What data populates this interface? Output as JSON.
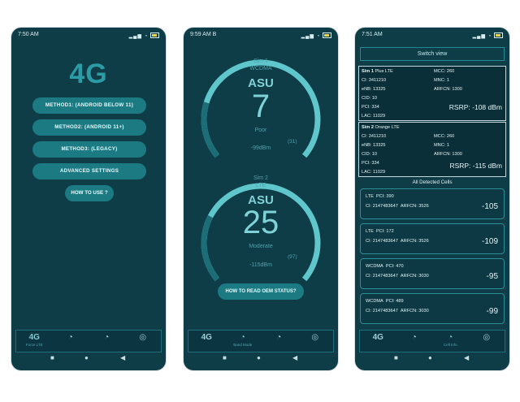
{
  "phone1": {
    "status_time": "7:50 AM",
    "logo": "4G",
    "buttons": [
      "METHOD1: (ANDROID BELOW 11)",
      "METHOD2: (ANDROID 11+)",
      "METHOD3: (LEGACY)",
      "ADVANCED SETTINGS"
    ],
    "howto": "HOW TO USE ?",
    "nav": [
      {
        "icon": "4G",
        "label": "Force LTE"
      },
      {
        "icon": "speedometer-icon",
        "label": ""
      },
      {
        "icon": "speedometer-icon",
        "label": ""
      },
      {
        "icon": "radar-icon",
        "label": ""
      }
    ]
  },
  "phone2": {
    "status_time": "9:59 AM",
    "status_extra": "B",
    "sim1": {
      "label": "Sim 1",
      "tech": "WCDMA",
      "asu_label": "ASU",
      "value": "7",
      "quality": "Poor",
      "dbm": "-99dBm",
      "max": "(31)",
      "level": 0.22
    },
    "sim2": {
      "label": "Sim 2",
      "tech": "LTE",
      "asu_label": "ASU",
      "value": "25",
      "quality": "Moderate",
      "dbm": "-115dBm",
      "max": "(97)",
      "level": 0.26
    },
    "oem_button": "HOW TO READ OEM STATUS?",
    "nav": [
      {
        "icon": "4G",
        "label": ""
      },
      {
        "icon": "speedometer-icon",
        "label": "Band Mode"
      },
      {
        "icon": "speedometer-icon",
        "label": ""
      },
      {
        "icon": "radar-icon",
        "label": ""
      }
    ]
  },
  "phone3": {
    "status_time": "7:51 AM",
    "switch_label": "Switch view",
    "sim1": {
      "title": "Sim 1",
      "operator": "Plus LTE",
      "left": [
        "CI: 3411210",
        "eNB: 13325",
        "CID: 10",
        "PCI: 334",
        "LAC: 11029"
      ],
      "right": [
        "MCC: 260",
        "MNC: 1",
        "ARFCN: 1300"
      ],
      "rsrp": "RSRP: -108 dBm"
    },
    "sim2": {
      "title": "Sim 2",
      "operator": "Orange LTE",
      "left": [
        "CI: 3411210",
        "eNB: 13325",
        "CID: 10",
        "PCI: 334",
        "LAC: 11029"
      ],
      "right": [
        "MCC: 260",
        "MNC: 1",
        "ARFCN: 1300"
      ],
      "rsrp": "RSRP: -115 dBm"
    },
    "all_cells_title": "All Detected Cells",
    "cells": [
      {
        "tech": "LTE",
        "pci": "PCI: 390",
        "ci": "CI: 2147483647",
        "arfcn": "ARFCN: 3526",
        "value": "-105"
      },
      {
        "tech": "LTE",
        "pci": "PCI: 172",
        "ci": "CI: 2147483647",
        "arfcn": "ARFCN: 3526",
        "value": "-109"
      },
      {
        "tech": "WCDMA",
        "pci": "PCI: 470",
        "ci": "CI: 2147483647",
        "arfcn": "ARFCN: 3030",
        "value": "-95"
      },
      {
        "tech": "WCDMA",
        "pci": "PCI: 489",
        "ci": "CI: 2147483647",
        "arfcn": "ARFCN: 3030",
        "value": "-99"
      }
    ],
    "nav": [
      {
        "icon": "4G",
        "label": ""
      },
      {
        "icon": "speedometer-icon",
        "label": ""
      },
      {
        "icon": "speedometer-icon",
        "label": "Cell Info"
      },
      {
        "icon": "radar-icon",
        "label": ""
      }
    ]
  },
  "colors": {
    "bg": "#0e3c47",
    "accent": "#2b9ba6",
    "button": "#1c7a83",
    "arc": "#5fc6cc"
  }
}
